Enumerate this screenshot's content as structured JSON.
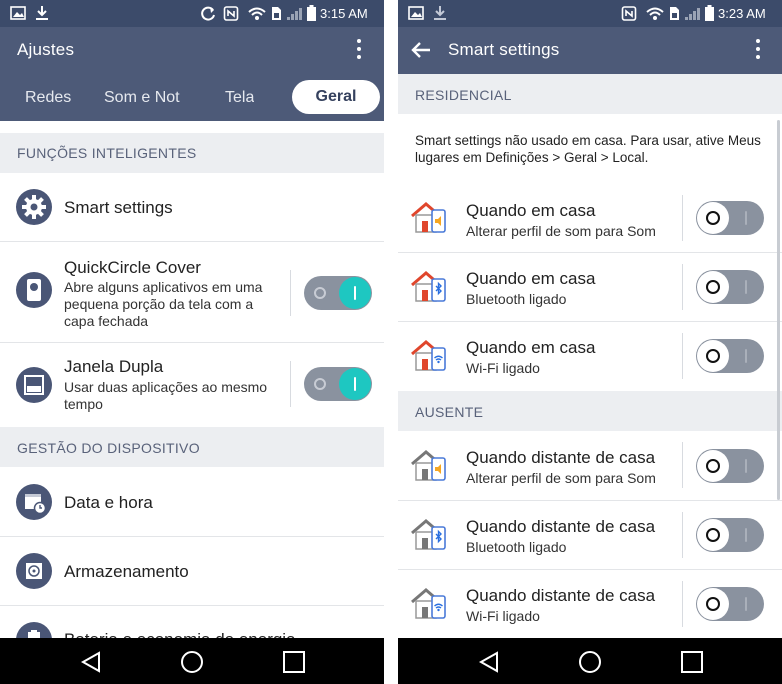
{
  "left": {
    "status": {
      "time": "3:15 AM"
    },
    "appbar": {
      "title": "Ajustes"
    },
    "tabs": [
      {
        "label": "Redes"
      },
      {
        "label": "Som e Not"
      },
      {
        "label": "Tela"
      },
      {
        "label": "Geral",
        "active": true
      }
    ],
    "sections": [
      {
        "label": "FUNÇÕES INTELIGENTES"
      },
      {
        "label": "GESTÃO DO DISPOSITIVO"
      }
    ],
    "rows": [
      {
        "label": "Smart settings",
        "icon": "gear-icon"
      },
      {
        "label": "QuickCircle Cover",
        "sub": "Abre alguns aplicativos em uma pequena porção da tela com a capa fechada",
        "icon": "quickcircle-icon",
        "toggle": "on"
      },
      {
        "label": "Janela Dupla",
        "sub": "Usar duas aplicações ao mesmo tempo",
        "icon": "dual-window-icon",
        "toggle": "on"
      },
      {
        "label": "Data e hora",
        "icon": "calendar-clock-icon"
      },
      {
        "label": "Armazenamento",
        "icon": "storage-icon"
      },
      {
        "label": "Bateria e economia de energia",
        "icon": "battery-icon"
      }
    ]
  },
  "right": {
    "status": {
      "time": "3:23 AM"
    },
    "appbar": {
      "title": "Smart settings"
    },
    "sections": [
      {
        "label": "RESIDENCIAL"
      },
      {
        "label": "AUSENTE"
      }
    ],
    "notice": "Smart settings não usado em casa. Para usar, ative Meus lugares em Definições > Geral > Local.",
    "home_rows": [
      {
        "label": "Quando em casa",
        "sub": "Alterar perfil de som para Som",
        "icon": "house-sound-icon",
        "toggle": "off"
      },
      {
        "label": "Quando em casa",
        "sub": "Bluetooth ligado",
        "icon": "house-bluetooth-icon",
        "toggle": "off"
      },
      {
        "label": "Quando em casa",
        "sub": "Wi-Fi ligado",
        "icon": "house-wifi-icon",
        "toggle": "off"
      }
    ],
    "away_rows": [
      {
        "label": "Quando distante de casa",
        "sub": "Alterar perfil de som para Som",
        "icon": "house-away-sound-icon",
        "toggle": "off"
      },
      {
        "label": "Quando distante de casa",
        "sub": "Bluetooth ligado",
        "icon": "house-away-bluetooth-icon",
        "toggle": "off"
      },
      {
        "label": "Quando distante de casa",
        "sub": "Wi-Fi ligado",
        "icon": "house-away-wifi-icon",
        "toggle": "off"
      }
    ]
  },
  "colors": {
    "statusbar": "#3c4b6a",
    "appbar": "#4d5a78",
    "accent": "#1ec7c1",
    "section_bg": "#eceef1"
  }
}
